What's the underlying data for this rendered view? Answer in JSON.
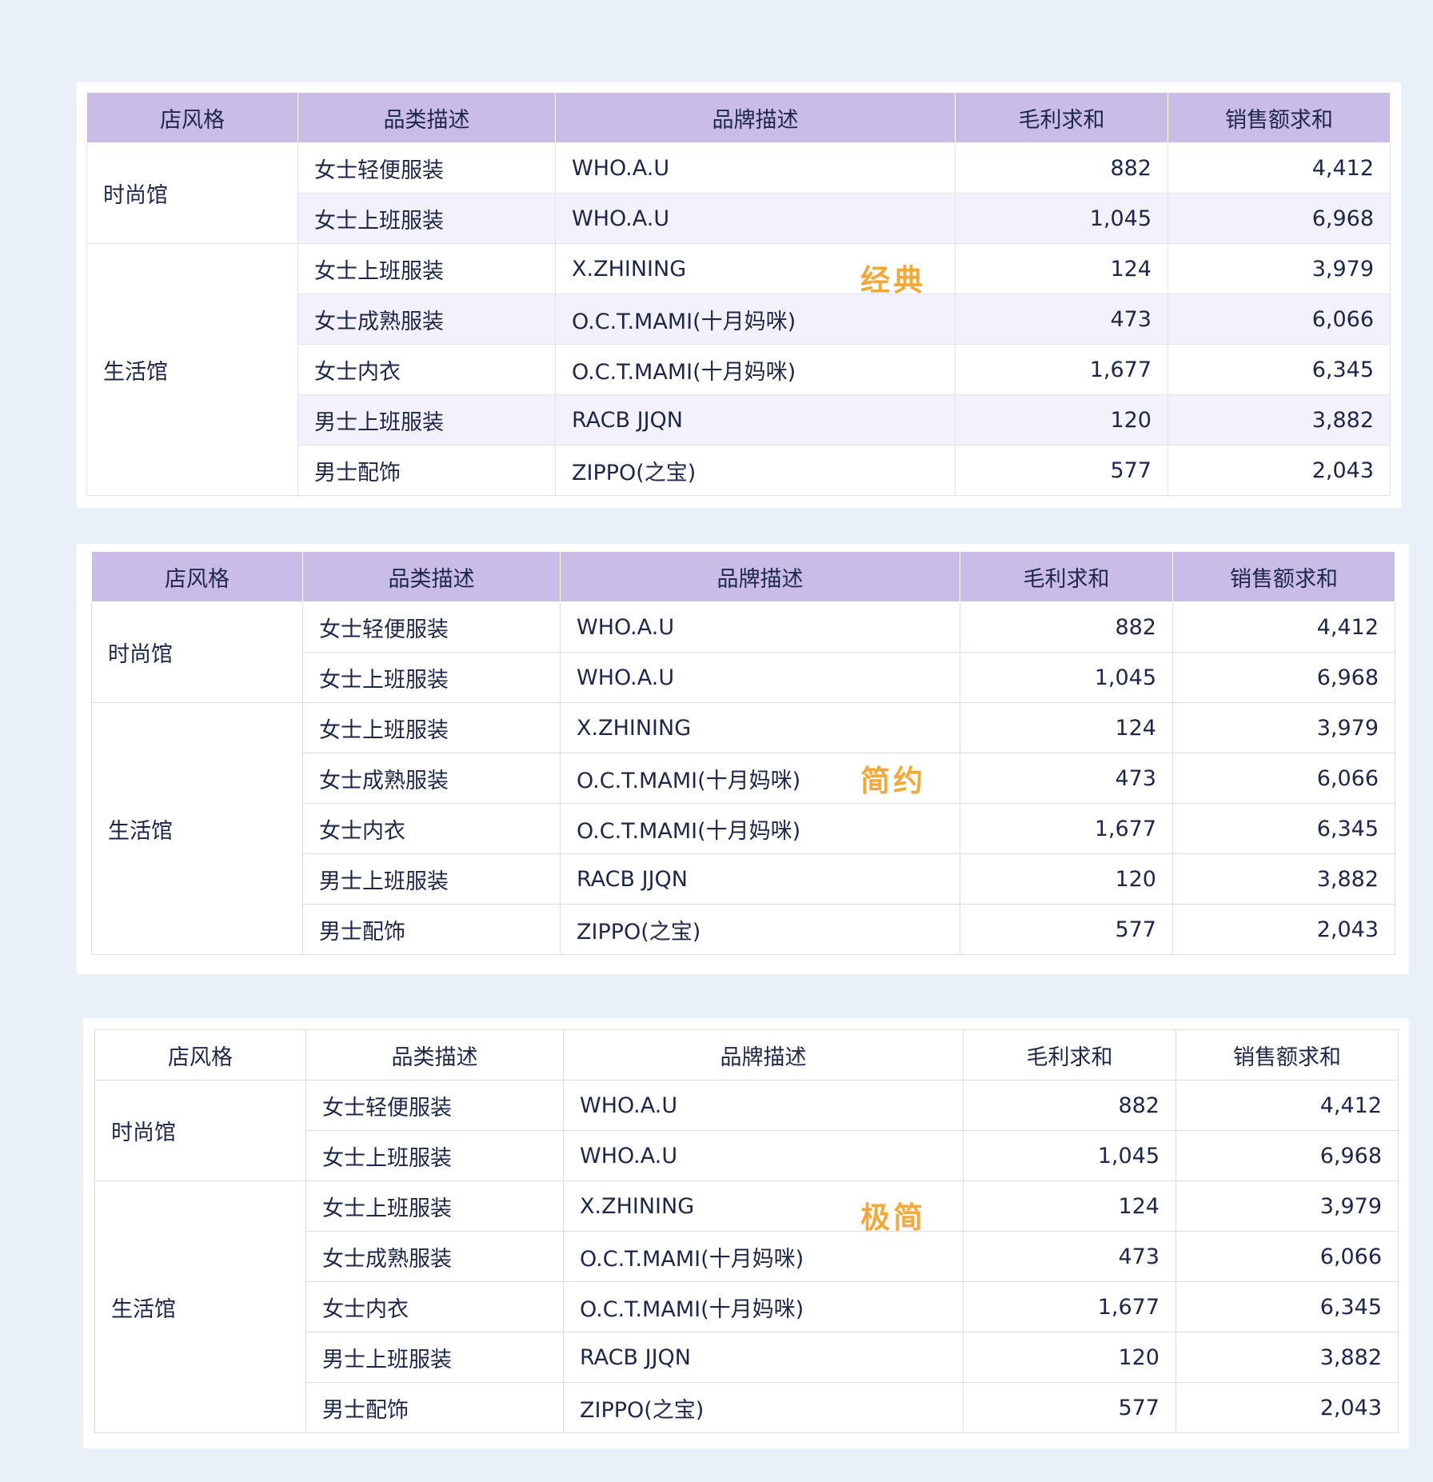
{
  "headers": [
    "店风格",
    "品类描述",
    "品牌描述",
    "毛利求和",
    "销售额求和"
  ],
  "rows": [
    {
      "style": "时尚馆",
      "category": "女士轻便服装",
      "brand": "WHO.A.U",
      "gross_profit": "882",
      "sales": "4,412"
    },
    {
      "style": "",
      "category": "女士上班服装",
      "brand": "WHO.A.U",
      "gross_profit": "1,045",
      "sales": "6,968"
    },
    {
      "style": "生活馆",
      "category": "女士上班服装",
      "brand": "X.ZHINING",
      "gross_profit": "124",
      "sales": "3,979"
    },
    {
      "style": "",
      "category": "女士成熟服装",
      "brand": "O.C.T.MAMI(十月妈咪)",
      "gross_profit": "473",
      "sales": "6,066"
    },
    {
      "style": "",
      "category": "女士内衣",
      "brand": "O.C.T.MAMI(十月妈咪)",
      "gross_profit": "1,677",
      "sales": "6,345"
    },
    {
      "style": "",
      "category": "男士上班服装",
      "brand": "RACB JJQN",
      "gross_profit": "120",
      "sales": "3,882"
    },
    {
      "style": "",
      "category": "男士配饰",
      "brand": "ZIPPO(之宝)",
      "gross_profit": "577",
      "sales": "2,043"
    }
  ],
  "groups": [
    {
      "label": "时尚馆",
      "span": 2
    },
    {
      "label": "生活馆",
      "span": 5
    }
  ],
  "themes": [
    {
      "id": "classic",
      "label": "经典",
      "header_color": "#c9bde8",
      "stripe_color": "#f3f1fb"
    },
    {
      "id": "simple",
      "label": "简约",
      "header_color": "#c9bde8"
    },
    {
      "id": "minimal",
      "label": "极简",
      "header_color": "#ffffff"
    }
  ],
  "accent_color": "#f2a93b"
}
